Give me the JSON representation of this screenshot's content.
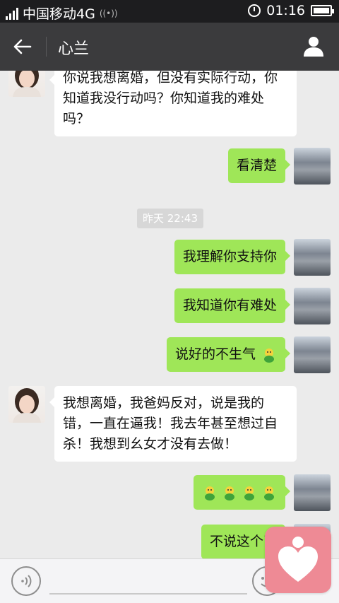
{
  "status_bar": {
    "carrier": "中国移动4G",
    "time": "01:16"
  },
  "header": {
    "title": "心兰"
  },
  "messages": [
    {
      "side": "in",
      "text": "你说我想离婚，但没有实际行动，你知道我没行动吗？你知道我的难处吗？"
    },
    {
      "side": "out",
      "text": "看清楚"
    },
    {
      "side": "out",
      "text": "我理解你支持你"
    },
    {
      "side": "out",
      "text": "我知道你有难处"
    },
    {
      "side": "out",
      "text": "说好的不生气"
    },
    {
      "side": "in",
      "text": "我想离婚，我爸妈反对，说是我的错，一直在逼我！我去年甚至想过自杀！我想到幺女才没有去做！"
    },
    {
      "side": "out",
      "text": ""
    },
    {
      "side": "out",
      "text": "不说这个了"
    }
  ],
  "timestamp": "昨天 22:43",
  "icons": {
    "back": "arrow-left-icon",
    "profile": "person-icon",
    "voice": "voice-icon",
    "emoji": "emoji-icon",
    "float": "heart-icon"
  },
  "colors": {
    "header_bg": "#3b3b3d",
    "status_bg": "#1d1d1f",
    "chat_bg": "#ebebeb",
    "bubble_out": "#9fe658",
    "bubble_in": "#ffffff",
    "float_widget": "#ee8a95"
  }
}
